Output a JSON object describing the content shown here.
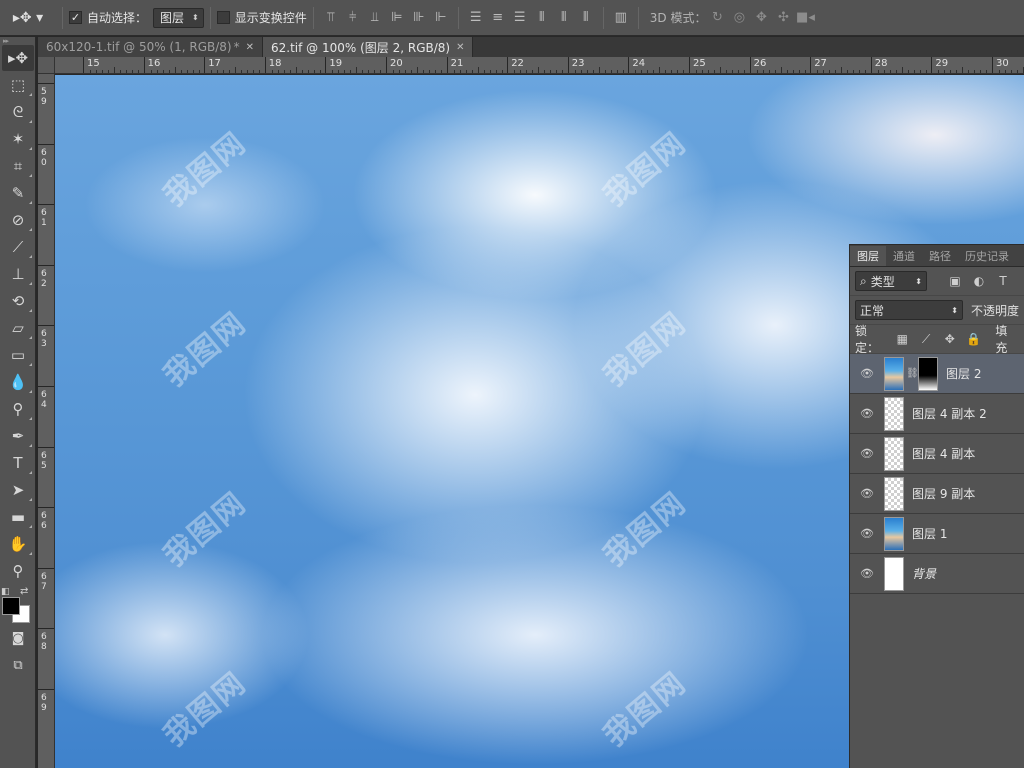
{
  "options_bar": {
    "auto_select_label": "自动选择：",
    "auto_select_checked": true,
    "auto_select_target": "图层",
    "show_transform_label": "显示变换控件",
    "show_transform_checked": false,
    "mode_3d_label": "3D 模式："
  },
  "tabs": [
    {
      "title": "60x120-1.tif @ 50% (1, RGB/8)",
      "modified_marker": "*",
      "active": false
    },
    {
      "title": "62.tif @ 100% (图层 2, RGB/8)",
      "modified_marker": "",
      "active": true
    }
  ],
  "ruler": {
    "top": [
      "15",
      "16",
      "17",
      "18",
      "19",
      "20",
      "21",
      "22",
      "23",
      "24",
      "25",
      "26",
      "27",
      "28",
      "29",
      "30"
    ],
    "left": [
      "59",
      "60",
      "61",
      "62",
      "63",
      "64",
      "65",
      "66",
      "67",
      "68",
      "69"
    ]
  },
  "watermark": "我图网",
  "layers_panel": {
    "tabs": [
      "图层",
      "通道",
      "路径",
      "历史记录"
    ],
    "filter_kind": "类型",
    "blend_mode": "正常",
    "opacity_label": "不透明度",
    "lock_label": "锁定：",
    "fill_label": "填充",
    "layers": [
      {
        "name": "图层 2",
        "thumb": "photo",
        "mask": true,
        "selected": true,
        "italic": false
      },
      {
        "name": "图层 4 副本 2",
        "thumb": "transparent",
        "mask": false,
        "selected": false,
        "italic": false
      },
      {
        "name": "图层 4 副本",
        "thumb": "transparent",
        "mask": false,
        "selected": false,
        "italic": false
      },
      {
        "name": "图层 9 副本",
        "thumb": "transparent",
        "mask": false,
        "selected": false,
        "italic": false
      },
      {
        "name": "图层 1",
        "thumb": "photo",
        "mask": false,
        "selected": false,
        "italic": false
      },
      {
        "name": "背景",
        "thumb": "white",
        "mask": false,
        "selected": false,
        "italic": true
      }
    ]
  },
  "colors": {
    "foreground": "#000000",
    "background": "#ffffff"
  }
}
